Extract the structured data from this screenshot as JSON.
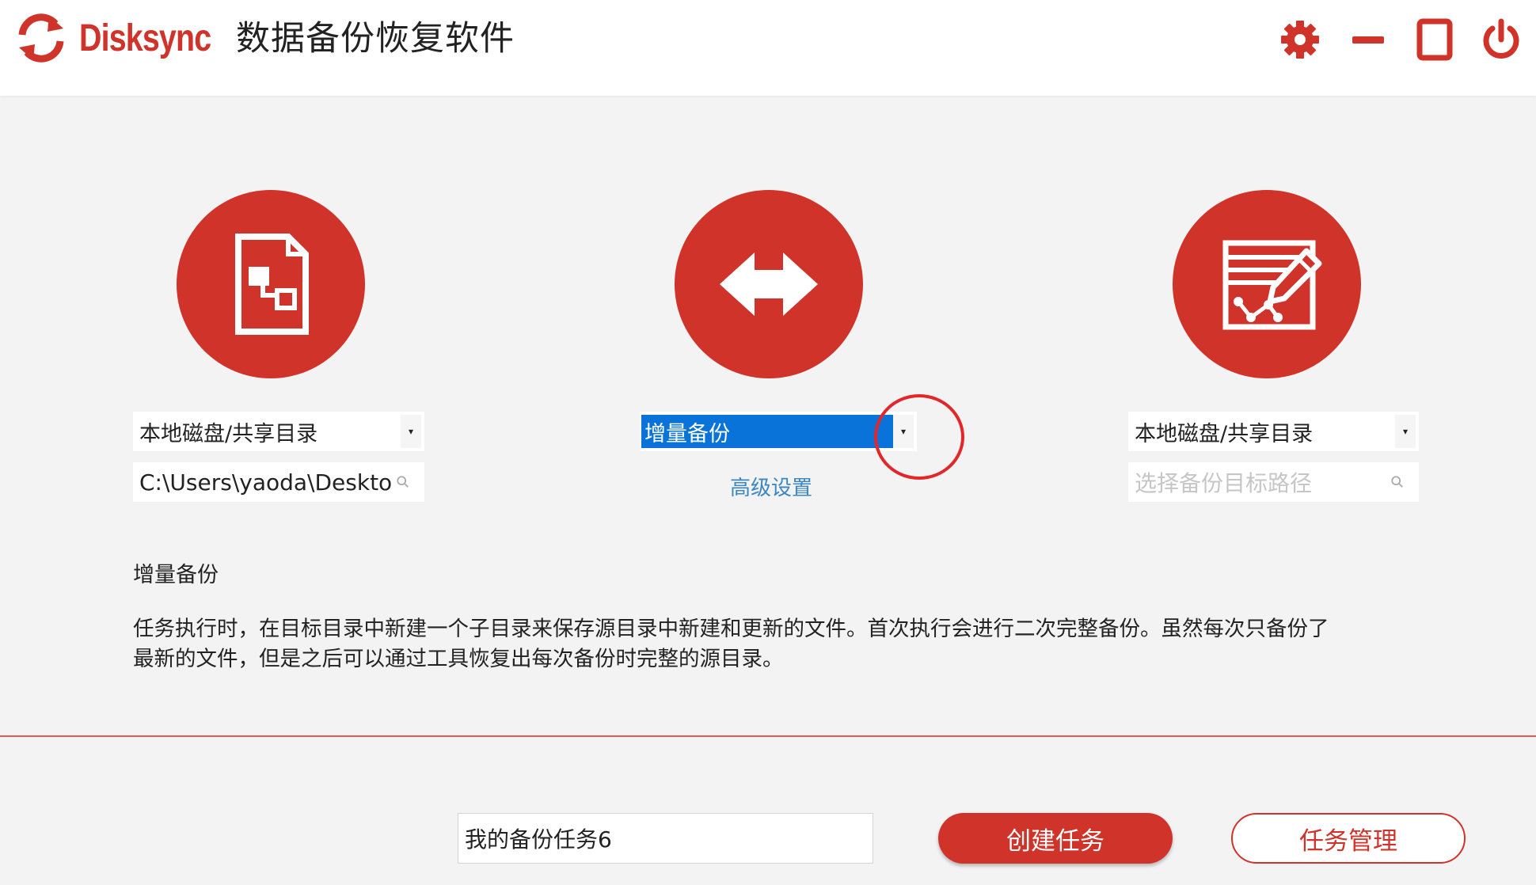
{
  "header": {
    "brand": "Disksync",
    "title": "数据备份恢复软件",
    "icons": [
      "sync-logo-icon",
      "gear-icon",
      "minimize-icon",
      "maximize-icon",
      "power-icon"
    ]
  },
  "source": {
    "type_selected": "本地磁盘/共享目录",
    "path_value": "C:\\Users\\yaoda\\Desktop"
  },
  "mode": {
    "selected": "增量备份",
    "advanced_link": "高级设置"
  },
  "target": {
    "type_selected": "本地磁盘/共享目录",
    "path_placeholder": "选择备份目标路径"
  },
  "description": {
    "title": "增量备份",
    "text_line1": "任务执行时，在目标目录中新建一个子目录来保存源目录中新建和更新的文件。首次执行会进行二次完整备份。虽然每次只备份了",
    "text_line2": "最新的文件，但是之后可以通过工具恢复出每次备份时完整的源目录。"
  },
  "footer": {
    "task_name": "我的备份任务6",
    "create_label": "创建任务",
    "manage_label": "任务管理"
  },
  "colors": {
    "brand_red": "#d0332a",
    "selection_blue": "#0a73d9",
    "link_blue": "#3b86c4",
    "annotation_ring": "#e3262a"
  }
}
